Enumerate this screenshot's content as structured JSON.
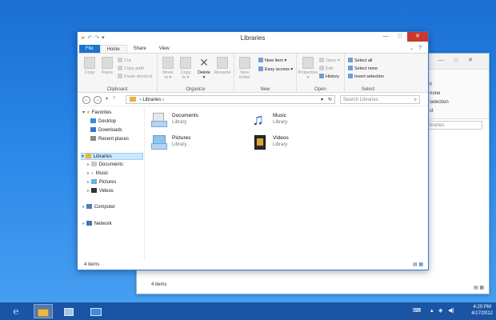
{
  "background_window": {
    "ribbon_items": [
      "ll",
      "none",
      "selection",
      "ct"
    ],
    "search_placeholder": "braries",
    "status": "4 items",
    "view_icons": "▤ ▦"
  },
  "window": {
    "title": "Libraries",
    "qat_icons": [
      "folder-icon",
      "undo-icon",
      "redo-icon",
      "dropdown-icon"
    ],
    "controls": {
      "minimize": "—",
      "maximize": "□",
      "close": "✕"
    },
    "tabs": [
      "File",
      "Home",
      "Share",
      "View"
    ],
    "active_tab": "Home",
    "ribbon": {
      "clipboard": {
        "label": "Clipboard",
        "copy": "Copy",
        "paste": "Paste",
        "cut": "Cut",
        "copy_path": "Copy path",
        "paste_shortcut": "Paste shortcut"
      },
      "organize": {
        "label": "Organize",
        "move_to": "Move\nto ▾",
        "copy_to": "Copy\nto ▾",
        "delete": "Delete\n▾",
        "rename": "Rename"
      },
      "new": {
        "label": "New",
        "new_folder": "New\nfolder",
        "new_item": "New item ▾",
        "easy_access": "Easy access ▾"
      },
      "open": {
        "label": "Open",
        "properties": "Properties\n▾",
        "open": "Open ▾",
        "edit": "Edit",
        "history": "History"
      },
      "select": {
        "label": "Select",
        "select_all": "Select all",
        "select_none": "Select none",
        "invert_selection": "Invert selection"
      }
    },
    "address": {
      "path": "Libraries",
      "search_placeholder": "Search Libraries"
    },
    "nav_pane": {
      "favorites": "Favorites",
      "desktop": "Desktop",
      "downloads": "Downloads",
      "recent_places": "Recent places",
      "libraries": "Libraries",
      "documents": "Documents",
      "music": "Music",
      "pictures": "Pictures",
      "videos": "Videos",
      "computer": "Computer",
      "network": "Network"
    },
    "libraries": [
      {
        "name": "Documents",
        "type": "Library"
      },
      {
        "name": "Music",
        "type": "Library"
      },
      {
        "name": "Pictures",
        "type": "Library"
      },
      {
        "name": "Videos",
        "type": "Library"
      }
    ],
    "status": "4 items"
  },
  "taskbar": {
    "time": "4:20 PM",
    "date": "4/17/2012"
  },
  "colors": {
    "accent": "#1a74cf",
    "close": "#c7392f",
    "selection": "#cce8ff"
  }
}
